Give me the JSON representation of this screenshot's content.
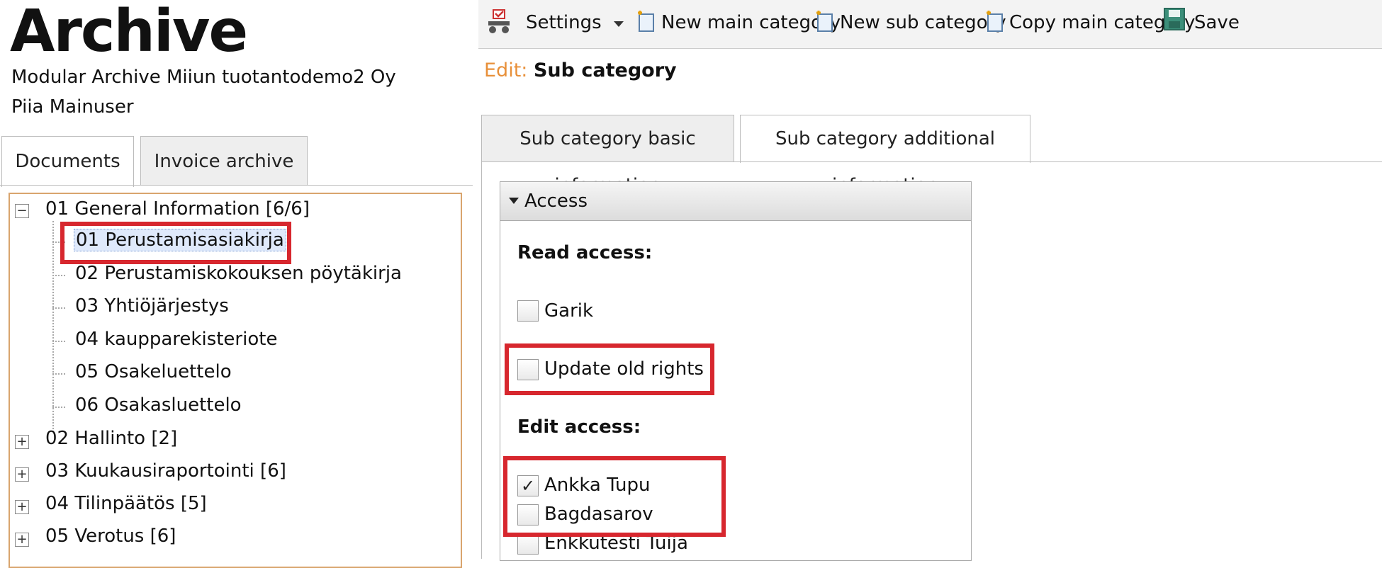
{
  "header": {
    "app_title": "Archive",
    "organization": "Modular Archive Miiun tuotantodemo2 Oy",
    "user": "Piia Mainuser"
  },
  "left_tabs": [
    {
      "label": "Documents",
      "active": true
    },
    {
      "label": "Invoice archive",
      "active": false
    }
  ],
  "tree": {
    "expanded_group": {
      "label": "01 General Information [6/6]",
      "toggle": "−"
    },
    "children": [
      "01 Perustamisasiakirja",
      "02 Perustamiskokouksen pöytäkirja",
      "03 Yhtiöjärjestys",
      "04 kaupparekisteriote",
      "05 Osakeluettelo",
      "06 Osakasluettelo"
    ],
    "collapsed_groups": [
      "02 Hallinto [2]",
      "03 Kuukausiraportointi [6]",
      "04 Tilinpäätös [5]",
      "05 Verotus [6]"
    ],
    "collapsed_toggle": "+"
  },
  "toolbar": {
    "settings": "Settings",
    "new_main": "New main category",
    "new_sub": "New sub category",
    "copy_main": "Copy main category",
    "save": "Save"
  },
  "edit": {
    "label": "Edit:",
    "value": "Sub category"
  },
  "right_tabs": [
    {
      "label": "Sub category basic information",
      "active": false
    },
    {
      "label": "Sub category additional information",
      "active": true
    }
  ],
  "access": {
    "title": "Access",
    "read_label": "Read access:",
    "read_users": [
      {
        "name": "Garik",
        "checked": false
      }
    ],
    "update_old_rights": {
      "label": "Update old rights",
      "checked": false
    },
    "edit_label": "Edit access:",
    "edit_users": [
      {
        "name": "Ankka Tupu",
        "checked": true
      },
      {
        "name": "Bagdasarov",
        "checked": false
      },
      {
        "name": "Enkkutesti Tuija",
        "checked": false
      }
    ],
    "check_glyph": "✓"
  },
  "colors": {
    "highlight": "#d7272e",
    "edit_label": "#e8903a",
    "tree_border": "#d9a56e"
  }
}
